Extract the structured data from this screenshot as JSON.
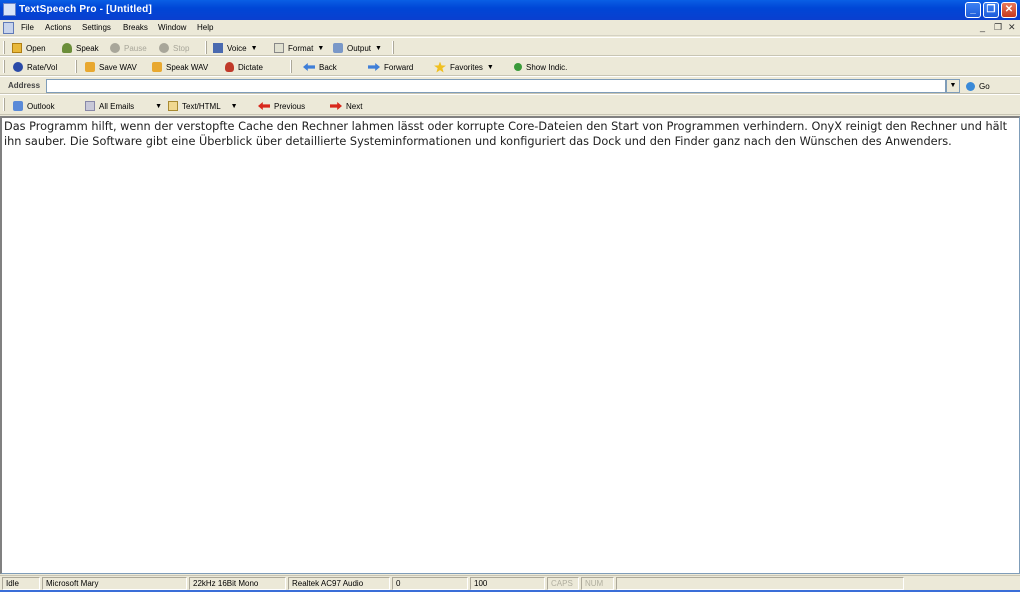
{
  "window": {
    "title": "TextSpeech Pro - [Untitled]"
  },
  "menu": [
    "File",
    "Actions",
    "Settings",
    "Breaks",
    "Window",
    "Help"
  ],
  "toolbar_main": {
    "open": "Open",
    "speak": "Speak",
    "pause": "Pause",
    "stop": "Stop",
    "voice": "Voice",
    "format": "Format",
    "output": "Output"
  },
  "toolbar_nav": {
    "rate_vol": "Rate/Vol",
    "save_wav": "Save WAV",
    "speak_wav": "Speak WAV",
    "dictate": "Dictate",
    "back": "Back",
    "forward": "Forward",
    "favorites": "Favorites",
    "show_indic": "Show Indic."
  },
  "address_bar": {
    "label": "Address",
    "value": "",
    "go": "Go"
  },
  "toolbar_email": {
    "outlook": "Outlook",
    "all_emails": "All Emails",
    "text_html": "Text/HTML",
    "previous": "Previous",
    "next": "Next"
  },
  "document": {
    "text": "Das Programm hilft, wenn der verstopfte Cache den Rechner lahmen lässt oder korrupte Core-Dateien den Start von Programmen verhindern. OnyX reinigt den Rechner und hält ihn sauber. Die Software gibt eine Überblick über detaillierte Systeminformationen und konfiguriert das Dock und den Finder ganz nach den Wünschen des Anwenders."
  },
  "status": {
    "state": "Idle",
    "voice": "Microsoft Mary",
    "format": "22kHz 16Bit Mono",
    "device": "Realtek AC97 Audio",
    "position": "0",
    "volume": "100",
    "caps": "CAPS",
    "num": "NUM"
  },
  "colors": {
    "titlebar": "#0a5fe5",
    "toolbar": "#ece9d8",
    "close_button": "#c7391d"
  }
}
